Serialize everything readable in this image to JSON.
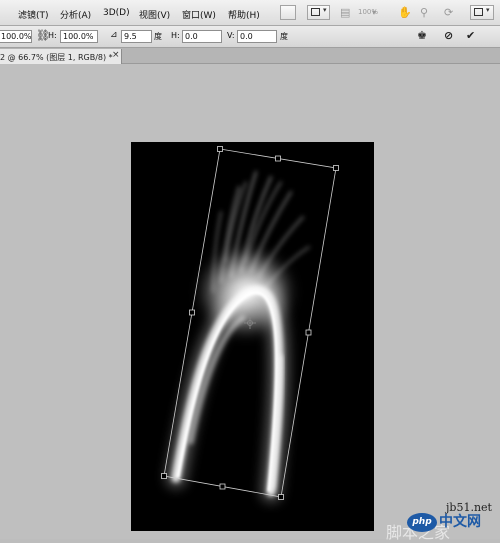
{
  "menu": {
    "items": [
      "滤镜(T)",
      "分析(A)",
      "3D(D)",
      "视图(V)",
      "窗口(W)",
      "帮助(H)"
    ],
    "zoom_display": "100%"
  },
  "options": {
    "w_value": "100.0%",
    "h_label": "H:",
    "h_value": "100.0%",
    "angle_value": "9.5",
    "angle_unit": "度",
    "hskew_label": "H:",
    "hskew_value": "0.0",
    "vskew_label": "V:",
    "vskew_value": "0.0",
    "hskew_unit": "度",
    "vskew_unit": "度"
  },
  "document": {
    "tab_title": "2 @ 66.7% (图层 1, RGB/8) *",
    "close_glyph": "×"
  },
  "watermark": {
    "site": "jb51.net",
    "badge": "php",
    "brand": "中文网",
    "cjk_text": "脚本之家"
  },
  "icons": {
    "link": "link-icon",
    "angle": "angle-icon",
    "warp": "warp-icon",
    "cancel": "cancel-transform-icon",
    "commit": "commit-transform-icon",
    "hand": "hand-icon",
    "zoom": "zoom-icon",
    "rotate": "rotate-view-icon",
    "arrange": "arrange-documents-icon",
    "screen": "screen-mode-icon",
    "bridge": "bridge-icon",
    "minibridge": "mini-bridge-icon"
  }
}
